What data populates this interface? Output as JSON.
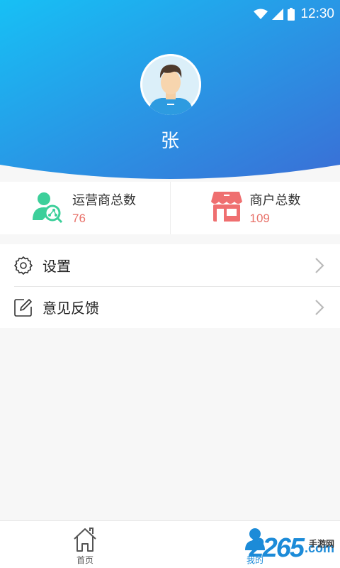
{
  "status_bar": {
    "time": "12:30"
  },
  "profile": {
    "name": "张"
  },
  "stats": [
    {
      "label": "运营商总数",
      "value": "76",
      "icon": "operator-search-icon"
    },
    {
      "label": "商户总数",
      "value": "109",
      "icon": "shop-icon"
    }
  ],
  "menu": [
    {
      "label": "设置",
      "icon": "gear-icon"
    },
    {
      "label": "意见反馈",
      "icon": "edit-icon"
    }
  ],
  "tabs": [
    {
      "label": "首页",
      "icon": "home-icon"
    },
    {
      "label": "我的",
      "icon": "user-icon"
    }
  ],
  "watermark": {
    "number": "2265",
    "suffix": ".com",
    "site": "手游网"
  },
  "colors": {
    "header_start": "#17c0f5",
    "header_end": "#3a6fd6",
    "accent_value": "#e8726a",
    "active_tab": "#1c8bd8"
  }
}
